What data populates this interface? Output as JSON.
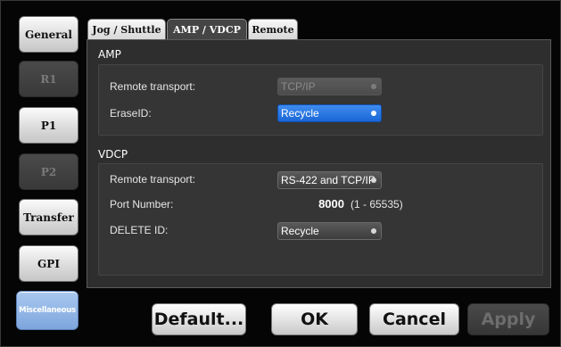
{
  "nav": [
    {
      "label": "General",
      "state": "normal"
    },
    {
      "label": "R1",
      "state": "disabled"
    },
    {
      "label": "P1",
      "state": "normal"
    },
    {
      "label": "P2",
      "state": "disabled"
    },
    {
      "label": "Transfer",
      "state": "normal"
    },
    {
      "label": "GPI",
      "state": "normal"
    },
    {
      "label": "Miscellaneous",
      "state": "active"
    }
  ],
  "tabs": [
    {
      "label": "Jog / Shuttle",
      "active": false
    },
    {
      "label": "AMP / VDCP",
      "active": true
    },
    {
      "label": "Remote",
      "active": false
    }
  ],
  "amp": {
    "title": "AMP",
    "remote_transport_label": "Remote transport:",
    "remote_transport_value": "TCP/IP",
    "erase_id_label": "EraseID:",
    "erase_id_value": "Recycle"
  },
  "vdcp": {
    "title": "VDCP",
    "remote_transport_label": "Remote transport:",
    "remote_transport_value": "RS-422 and TCP/IP",
    "port_number_label": "Port Number:",
    "port_number_value": "8000",
    "port_number_range": "(1 - 65535)",
    "delete_id_label": "DELETE ID:",
    "delete_id_value": "Recycle"
  },
  "buttons": {
    "default": "Default...",
    "ok": "OK",
    "cancel": "Cancel",
    "apply": "Apply"
  },
  "colors": {
    "selected_dropdown": "#1a66d6",
    "active_nav": "#7ea6dd",
    "panel_bg": "#2e2e2e"
  }
}
